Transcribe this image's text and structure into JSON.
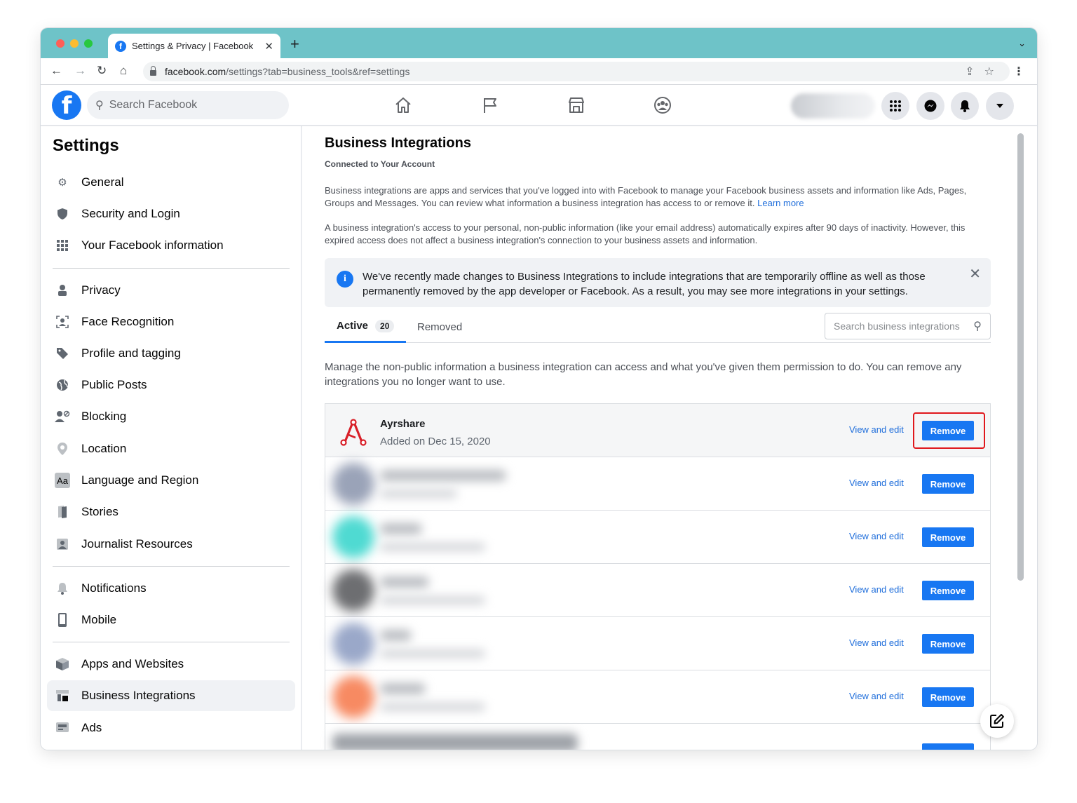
{
  "browser": {
    "tab_title": "Settings & Privacy | Facebook",
    "url_domain": "facebook.com",
    "url_path": "/settings?tab=business_tools&ref=settings"
  },
  "header": {
    "search_placeholder": "Search Facebook",
    "nav_icons": [
      "home-icon",
      "flag-icon",
      "marketplace-icon",
      "groups-icon"
    ],
    "right_icons": [
      "menu-grid-icon",
      "messenger-icon",
      "notifications-bell-icon",
      "account-caret-icon"
    ]
  },
  "sidebar": {
    "title": "Settings",
    "groups": [
      [
        {
          "label": "General",
          "icon": "gear-icon"
        },
        {
          "label": "Security and Login",
          "icon": "shield-icon"
        },
        {
          "label": "Your Facebook information",
          "icon": "grid-icon"
        }
      ],
      [
        {
          "label": "Privacy",
          "icon": "lock-person-icon"
        },
        {
          "label": "Face Recognition",
          "icon": "face-icon"
        },
        {
          "label": "Profile and tagging",
          "icon": "tag-icon"
        },
        {
          "label": "Public Posts",
          "icon": "globe-icon"
        },
        {
          "label": "Blocking",
          "icon": "block-user-icon"
        },
        {
          "label": "Location",
          "icon": "location-pin-icon"
        },
        {
          "label": "Language and Region",
          "icon": "language-icon"
        },
        {
          "label": "Stories",
          "icon": "book-icon"
        },
        {
          "label": "Journalist Resources",
          "icon": "id-card-icon"
        }
      ],
      [
        {
          "label": "Notifications",
          "icon": "bell-icon"
        },
        {
          "label": "Mobile",
          "icon": "phone-icon"
        }
      ],
      [
        {
          "label": "Apps and Websites",
          "icon": "cube-icon"
        },
        {
          "label": "Business Integrations",
          "icon": "business-icon",
          "active": true
        },
        {
          "label": "Ads",
          "icon": "ads-icon"
        }
      ]
    ]
  },
  "main": {
    "title": "Business Integrations",
    "subtitle": "Connected to Your Account",
    "para1": "Business integrations are apps and services that you've logged into with Facebook to manage your Facebook business assets and information like Ads, Pages, Groups and Messages. You can review what information a business integration has access to or remove it.",
    "learn_more": "Learn more",
    "para2": "A business integration's access to your personal, non-public information (like your email address) automatically expires after 90 days of inactivity. However, this expired access does not affect a business integration's connection to your business assets and information.",
    "notice": "We've recently made changes to Business Integrations to include integrations that are temporarily offline as well as those permanently removed by the app developer or Facebook. As a result, you may see more integrations in your settings.",
    "tabs": {
      "active_label": "Active",
      "active_count": "20",
      "removed_label": "Removed",
      "search_placeholder": "Search business integrations"
    },
    "description": "Manage the non-public information a business integration can access and what you've given them permission to do. You can remove any integrations you no longer want to use.",
    "integrations": [
      {
        "name": "Ayrshare",
        "added": "Added on Dec 15, 2020",
        "view": "View and edit",
        "remove": "Remove",
        "highlighted": true
      },
      {
        "name": "",
        "added": "",
        "view": "View and edit",
        "remove": "Remove",
        "logo_color": "#9aa3b8"
      },
      {
        "name": "",
        "added": "",
        "view": "View and edit",
        "remove": "Remove",
        "logo_color": "#4fdad2"
      },
      {
        "name": "",
        "added": "",
        "view": "View and edit",
        "remove": "Remove",
        "logo_color": "#6d6e71"
      },
      {
        "name": "",
        "added": "",
        "view": "View and edit",
        "remove": "Remove",
        "logo_color": "#9aa8c9"
      },
      {
        "name": "",
        "added": "",
        "view": "View and edit",
        "remove": "Remove",
        "logo_color": "#f78a62"
      }
    ]
  },
  "colors": {
    "accent": "#1877f2",
    "link": "#216fdb",
    "highlight_box": "#e0171c",
    "tabbar": "#6ec3c8"
  }
}
